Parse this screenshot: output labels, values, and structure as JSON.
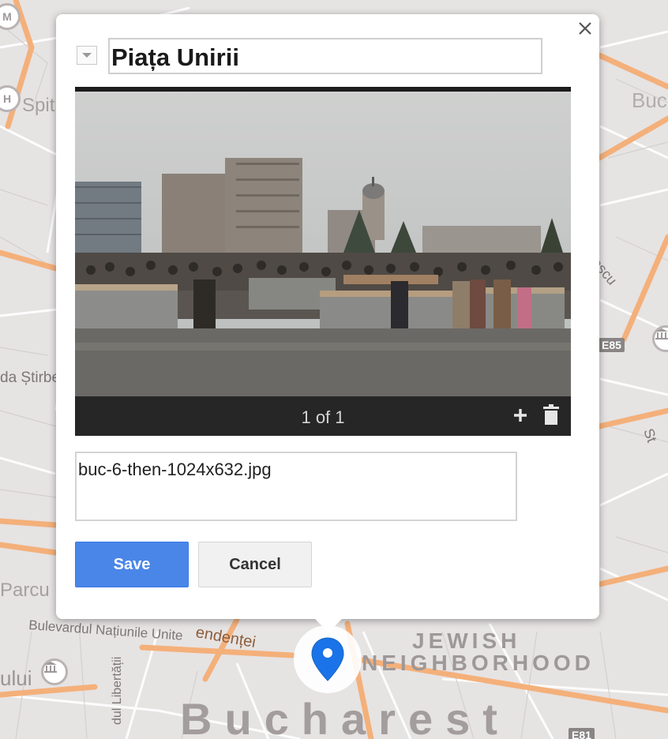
{
  "map": {
    "labels": {
      "spit": "Spit",
      "buc": "Buc",
      "stirbe": "da Știrbe",
      "parcu": "Parcu",
      "ului": "ului",
      "bulevardul": "Bulevardul Națiunile Unite",
      "libertatii": "dul Libertății",
      "endentei": "endenței",
      "jewish": "JEWISH",
      "neighborhood": "NEIGHBORHOOD",
      "bucharest": "Bucharest",
      "inescu": "inescu",
      "st": "St"
    },
    "shields": {
      "e85": "E85",
      "e81": "E81"
    },
    "poi": {
      "h": "H",
      "m": "M"
    },
    "colors": {
      "background": "#e6e3e3",
      "roads_major": "#f6b37a",
      "roads_minor": "#ffffff"
    }
  },
  "popup": {
    "title": "Piața Unirii",
    "photo": {
      "counter": "1 of 1"
    },
    "description": "buc-6-then-1024x632.jpg",
    "buttons": {
      "save": "Save",
      "cancel": "Cancel"
    },
    "icons": {
      "close": "close-icon",
      "style": "chevron-down-icon",
      "add": "plus-icon",
      "delete": "trash-icon",
      "marker": "map-pin-icon"
    },
    "colors": {
      "save": "#4a86e8",
      "marker": "#1a73e8"
    }
  }
}
